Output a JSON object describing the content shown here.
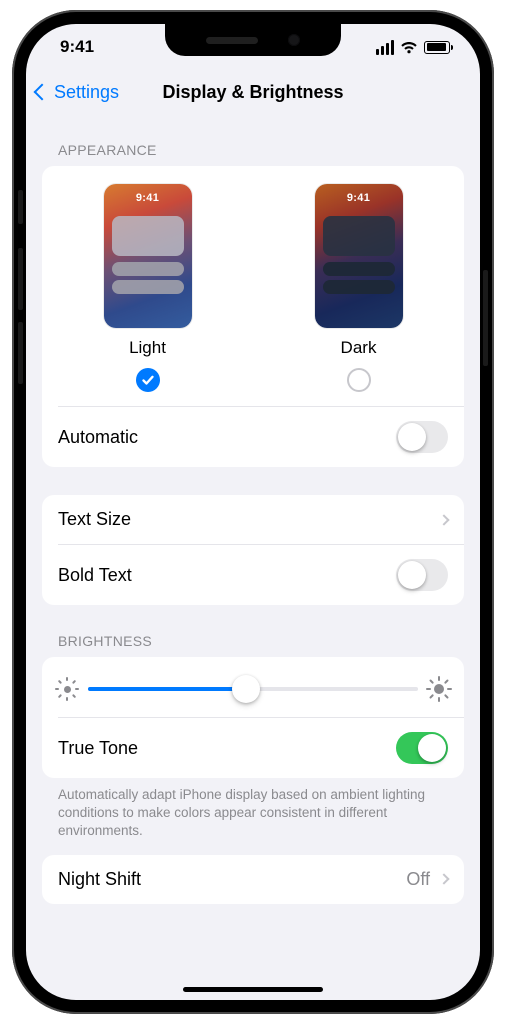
{
  "status": {
    "time": "9:41"
  },
  "nav": {
    "back": "Settings",
    "title": "Display & Brightness"
  },
  "appearance": {
    "header": "APPEARANCE",
    "options": [
      {
        "label": "Light",
        "preview_time": "9:41",
        "selected": true
      },
      {
        "label": "Dark",
        "preview_time": "9:41",
        "selected": false
      }
    ],
    "automatic": {
      "label": "Automatic",
      "on": false
    }
  },
  "text": {
    "text_size": {
      "label": "Text Size"
    },
    "bold_text": {
      "label": "Bold Text",
      "on": false
    }
  },
  "brightness": {
    "header": "BRIGHTNESS",
    "value_percent": 48,
    "true_tone": {
      "label": "True Tone",
      "on": true
    },
    "footer": "Automatically adapt iPhone display based on ambient lighting conditions to make colors appear consistent in different environments."
  },
  "night_shift": {
    "label": "Night Shift",
    "value": "Off"
  }
}
